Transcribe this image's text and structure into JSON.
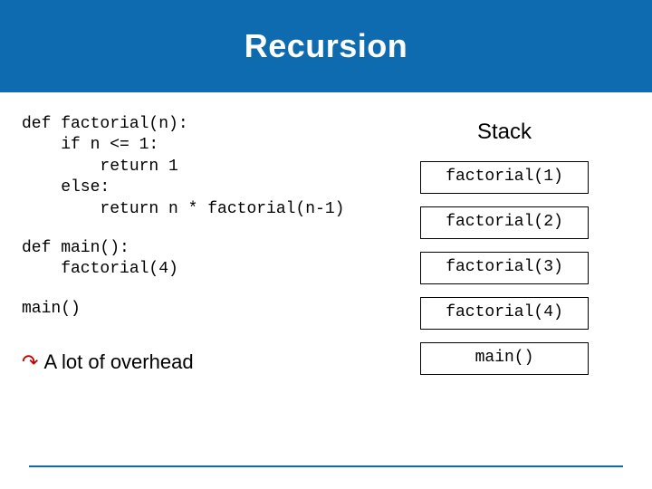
{
  "title": "Recursion",
  "code": {
    "block1": "def factorial(n):\n    if n <= 1:\n        return 1\n    else:\n        return n * factorial(n-1)",
    "block2": "def main():\n    factorial(4)",
    "block3": "main()"
  },
  "bullet": {
    "icon": "↷",
    "text": "A lot of overhead"
  },
  "stack": {
    "title": "Stack",
    "frames": [
      "factorial(1)",
      "factorial(2)",
      "factorial(3)",
      "factorial(4)",
      "main()"
    ]
  },
  "colors": {
    "brand": "#0e6bb0",
    "accent": "#c00000"
  }
}
